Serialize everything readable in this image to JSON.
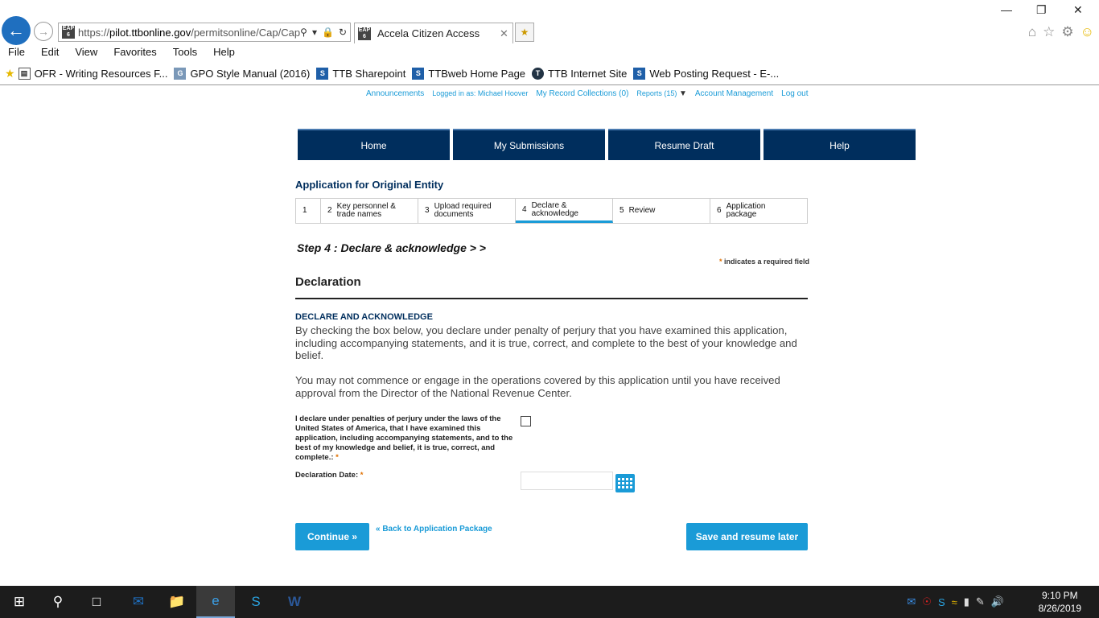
{
  "browser": {
    "address_domain": "pilot.ttbonline.gov",
    "address_prefix": "https://",
    "address_path": "/permitsonline/Cap/Cap",
    "favicon_text": "EAP 6",
    "tab_title": "Accela Citizen Access",
    "window_controls": {
      "minimize": "—",
      "restore": "❐",
      "close": "✕"
    },
    "menu": [
      "File",
      "Edit",
      "View",
      "Favorites",
      "Tools",
      "Help"
    ],
    "favorites": [
      {
        "label": "OFR - Writing Resources F...",
        "icon": "page-icon"
      },
      {
        "label": "GPO Style Manual (2016)",
        "icon": "gpo-icon"
      },
      {
        "label": "TTB Sharepoint",
        "icon": "sharepoint-icon"
      },
      {
        "label": "TTBweb Home Page",
        "icon": "sharepoint-icon"
      },
      {
        "label": "TTB Internet Site",
        "icon": "ttb-seal-icon"
      },
      {
        "label": "Web Posting Request - E-...",
        "icon": "sharepoint-icon"
      }
    ]
  },
  "page": {
    "top_links": {
      "announcements": "Announcements",
      "logged_in": "Logged in as: Michael Hoover",
      "collections": "My Record Collections (0)",
      "reports": "Reports (15)",
      "account": "Account Management",
      "logout": "Log out"
    },
    "main_nav": [
      "Home",
      "My Submissions",
      "Resume Draft",
      "Help"
    ],
    "app_title": "Application for Original Entity",
    "steps": [
      {
        "num": "1",
        "label": ""
      },
      {
        "num": "2",
        "label": "Key personnel & trade names"
      },
      {
        "num": "3",
        "label": "Upload required documents"
      },
      {
        "num": "4",
        "label": "Declare & acknowledge"
      },
      {
        "num": "5",
        "label": "Review"
      },
      {
        "num": "6",
        "label": "Application package"
      }
    ],
    "active_step": 4,
    "step_heading": "Step 4 : Declare & acknowledge > >",
    "required_note_star": "*",
    "required_note": " indicates a required field",
    "section_title": "Declaration",
    "section_subtitle": "DECLARE AND ACKNOWLEDGE",
    "paragraph1": "By checking the box below, you declare under penalty of perjury that you have examined this application, including accompanying statements, and it is true, correct, and complete to the best of your knowledge and belief.",
    "paragraph2": "You may not commence or engage in the operations covered by this application until you have received approval from the Director of the National Revenue Center.",
    "declaration_label": "I declare under penalties of perjury under the laws of the United States of America, that I have examined this application, including accompanying statements, and to the best of my knowledge and belief, it is true, correct, and complete.:",
    "declaration_checked": false,
    "date_label": "Declaration Date:",
    "date_value": "",
    "required_star": "*",
    "continue_button": "Continue »",
    "back_link": "« Back to Application Package",
    "save_button": "Save and resume later"
  },
  "taskbar": {
    "time": "9:10 PM",
    "date": "8/26/2019",
    "apps": [
      "start-icon",
      "search-icon",
      "task-view-icon",
      "outlook-icon",
      "file-explorer-icon",
      "internet-explorer-icon",
      "skype-icon",
      "word-icon"
    ]
  },
  "colors": {
    "nav_bg": "#002e5d",
    "accent": "#1a9bd7",
    "required": "#e07000"
  }
}
